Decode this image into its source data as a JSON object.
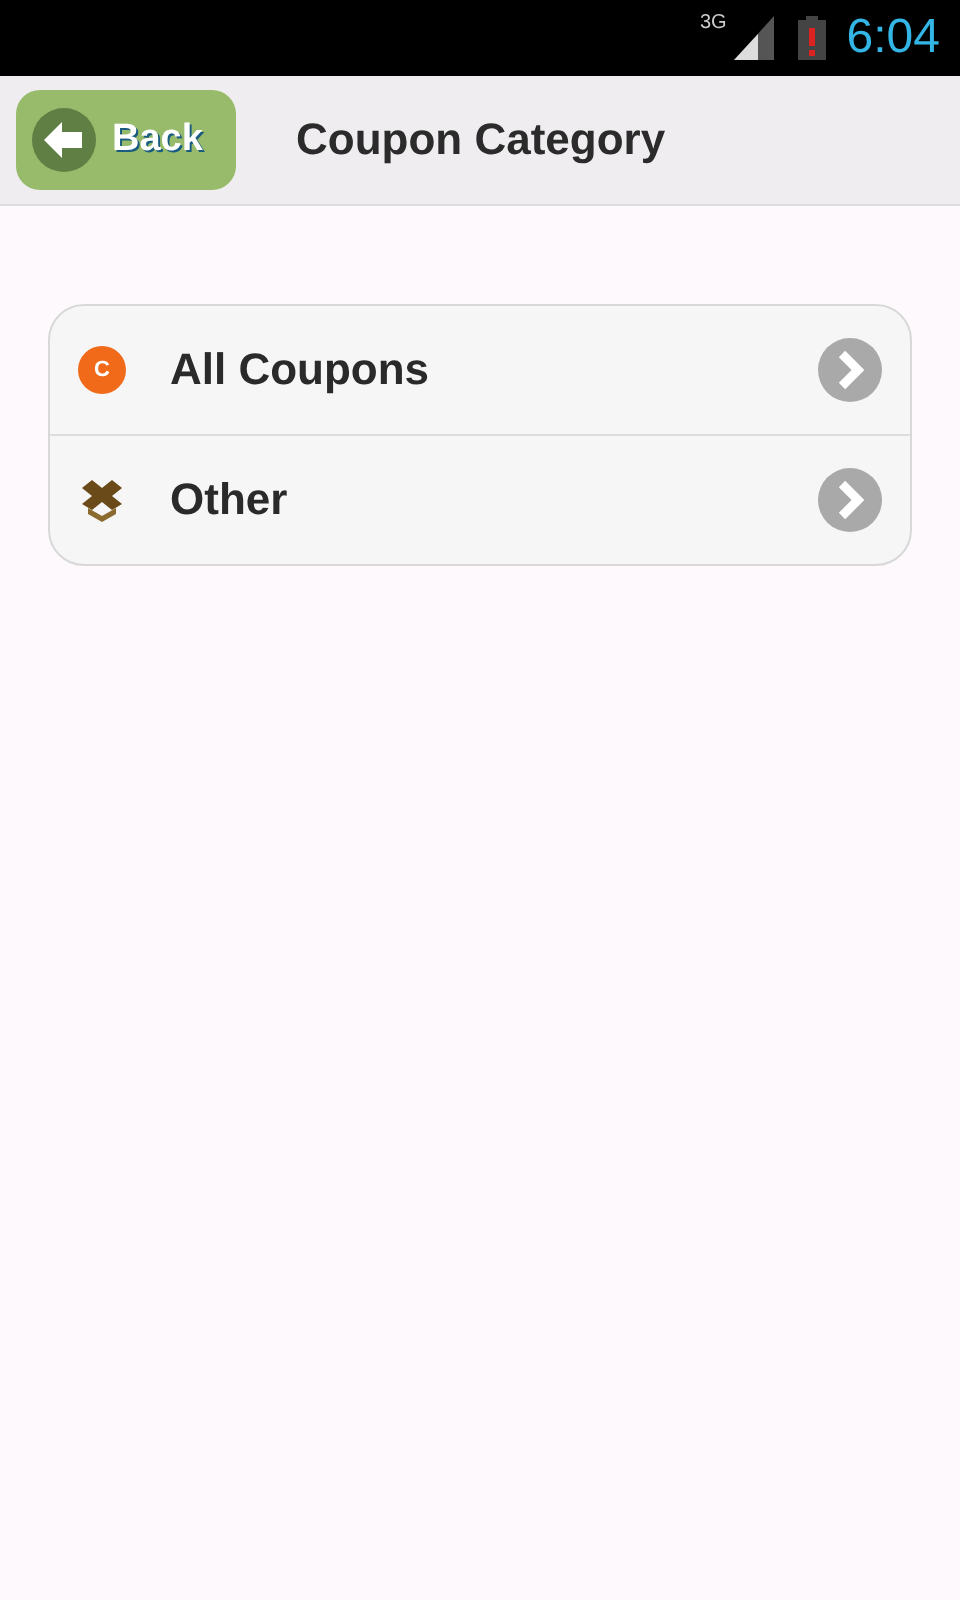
{
  "status_bar": {
    "network": "3G",
    "time": "6:04"
  },
  "header": {
    "back_button": "Back",
    "title": "Coupon Category"
  },
  "categories": [
    {
      "kind": "coupon",
      "icon_letter": "C",
      "label": "All Coupons"
    },
    {
      "kind": "box",
      "label": "Other"
    }
  ]
}
